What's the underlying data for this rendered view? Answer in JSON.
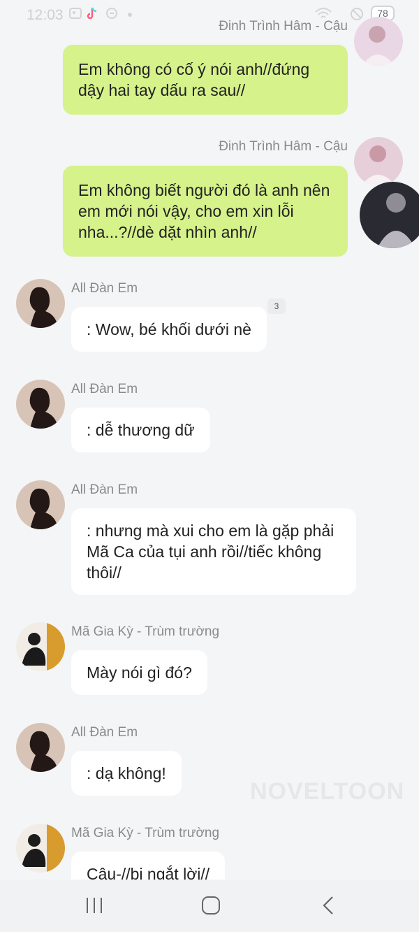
{
  "status_bar": {
    "time": "12:03",
    "battery": "78"
  },
  "messages": [
    {
      "sender": "Đinh Trình Hâm - Cậu",
      "text": "Em không có cố ý nói anh//đứng dậy hai tay dấu ra sau//"
    },
    {
      "sender": "Đinh Trình Hâm - Cậu",
      "text": "Em không biết người đó là anh nên em mới nói vậy, cho em xin lỗi nha...?//dè dặt nhìn anh//"
    },
    {
      "sender": "All Đàn Em",
      "text": ": Wow, bé khối dưới nè",
      "badge": "3"
    },
    {
      "sender": "All Đàn Em",
      "text": ": dễ thương dữ"
    },
    {
      "sender": "All Đàn Em",
      "text": ": nhưng mà xui cho em là gặp phải Mã Ca của tụi anh rồi//tiếc không thôi//"
    },
    {
      "sender": "Mã Gia Kỳ - Trùm trường",
      "text": "Mày nói gì đó?"
    },
    {
      "sender": "All Đàn Em",
      "text": ": dạ không!"
    },
    {
      "sender": "Mã Gia Kỳ - Trùm trường",
      "text": "Cậu-//bị ngắt lời//"
    }
  ],
  "watermark": "NOVELTOON",
  "colors": {
    "my_bubble": "#d6f28a",
    "other_bubble": "#ffffff",
    "background": "#f4f5f7"
  },
  "nav_bar": [
    "recent-apps",
    "home",
    "back"
  ]
}
